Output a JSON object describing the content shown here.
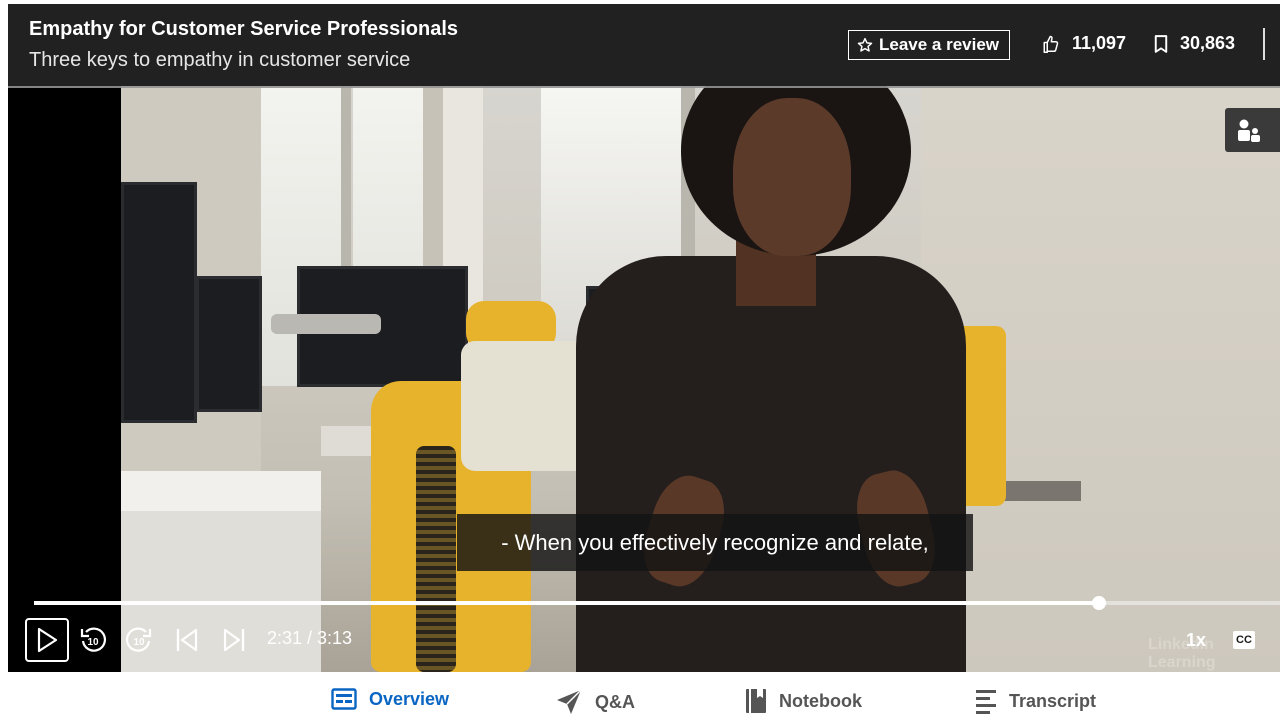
{
  "header": {
    "course_title": "Empathy for Customer Service Professionals",
    "video_title": "Three keys to empathy in customer service",
    "review_label": "Leave a review",
    "likes": "11,097",
    "saves": "30,863"
  },
  "caption": "- When you effectively recognize and relate,",
  "player": {
    "progress": 0.855,
    "time": "2:31 / 3:13",
    "speed": "1x",
    "cc_label": "CC",
    "watermark": "LinkedIn Learning"
  },
  "tabs": [
    {
      "label": "Overview",
      "icon": "overview-icon",
      "active": true
    },
    {
      "label": "Q&A",
      "icon": "paper-plane-icon",
      "active": false
    },
    {
      "label": "Notebook",
      "icon": "notebook-icon",
      "active": false
    },
    {
      "label": "Transcript",
      "icon": "transcript-icon",
      "active": false
    }
  ],
  "colors": {
    "accent": "#0a66c2",
    "overlay": "#282828",
    "chair_yellow": "#e7b32d"
  }
}
